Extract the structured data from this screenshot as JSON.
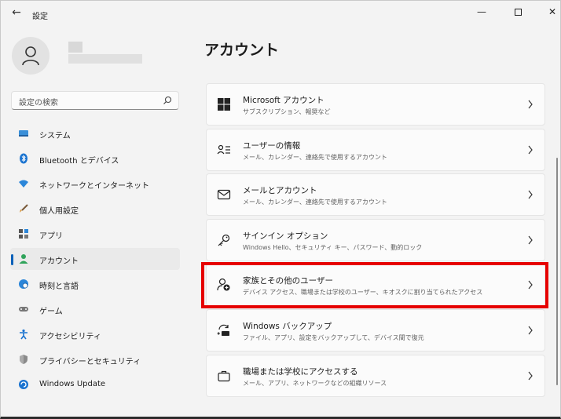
{
  "window": {
    "title": "設定",
    "back_glyph": "←",
    "min_glyph": "—",
    "close_glyph": "✕"
  },
  "search": {
    "placeholder": "設定の検索"
  },
  "sidebar": {
    "items": [
      {
        "label": "システム",
        "icon": "monitor-icon"
      },
      {
        "label": "Bluetooth とデバイス",
        "icon": "bluetooth-icon"
      },
      {
        "label": "ネットワークとインターネット",
        "icon": "wifi-icon"
      },
      {
        "label": "個人用設定",
        "icon": "brush-icon"
      },
      {
        "label": "アプリ",
        "icon": "apps-icon"
      },
      {
        "label": "アカウント",
        "icon": "person-icon",
        "selected": true
      },
      {
        "label": "時刻と言語",
        "icon": "globe-clock-icon"
      },
      {
        "label": "ゲーム",
        "icon": "gamepad-icon"
      },
      {
        "label": "アクセシビリティ",
        "icon": "accessibility-icon"
      },
      {
        "label": "プライバシーとセキュリティ",
        "icon": "shield-icon"
      },
      {
        "label": "Windows Update",
        "icon": "update-icon"
      }
    ]
  },
  "main": {
    "title": "アカウント",
    "cards": [
      {
        "title": "Microsoft アカウント",
        "subtitle": "サブスクリプション、報奨など",
        "icon": "windows-logo-icon"
      },
      {
        "title": "ユーザーの情報",
        "subtitle": "メール、カレンダー、連絡先で使用するアカウント",
        "icon": "user-info-icon"
      },
      {
        "title": "メールとアカウント",
        "subtitle": "メール、カレンダー、連絡先で使用するアカウント",
        "icon": "mail-icon"
      },
      {
        "title": "サインイン オプション",
        "subtitle": "Windows Hello、セキュリティ キー、パスワード、動的ロック",
        "icon": "key-icon"
      },
      {
        "title": "家族とその他のユーザー",
        "subtitle": "デバイス アクセス、職場または学校のユーザー、キオスクに割り当てられたアクセス",
        "icon": "add-user-icon"
      },
      {
        "title": "Windows バックアップ",
        "subtitle": "ファイル、アプリ、設定をバックアップして、デバイス間で復元",
        "icon": "backup-icon"
      },
      {
        "title": "職場または学校にアクセスする",
        "subtitle": "メール、アプリ、ネットワークなどの組織リソース",
        "icon": "briefcase-icon"
      }
    ]
  },
  "colors": {
    "accent": "#005fb8",
    "highlight": "#e60000"
  }
}
